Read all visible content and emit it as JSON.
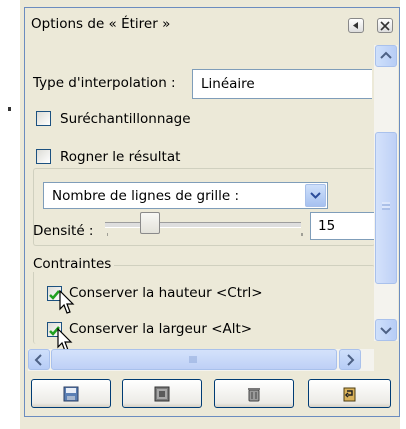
{
  "dialog": {
    "title": "Options de « Étirer »",
    "menu_button": "dialog-menu",
    "close_button": "close"
  },
  "interpolation": {
    "label": "Type d'interpolation :",
    "value": "Linéaire"
  },
  "supersampling": {
    "label": "Suréchantillonnage",
    "checked": false
  },
  "clip": {
    "label": "Rogner le résultat",
    "checked": false
  },
  "grid": {
    "mode_value": "Nombre de lignes de grille :",
    "density_label": "Densité :",
    "density_value": "15",
    "density_fraction": 0.2
  },
  "constraints": {
    "title": "Contraintes",
    "keep_height": {
      "label": "Conserver la hauteur <Ctrl>",
      "checked": true
    },
    "keep_width": {
      "label": "Conserver la largeur <Alt>",
      "checked": true
    }
  },
  "toolbar_buttons": [
    "save-options-icon",
    "restore-options-icon",
    "delete-options-icon",
    "reset-options-icon"
  ],
  "colors": {
    "accent": "#316ac5",
    "check": "#21a121",
    "border": "#003c74"
  }
}
